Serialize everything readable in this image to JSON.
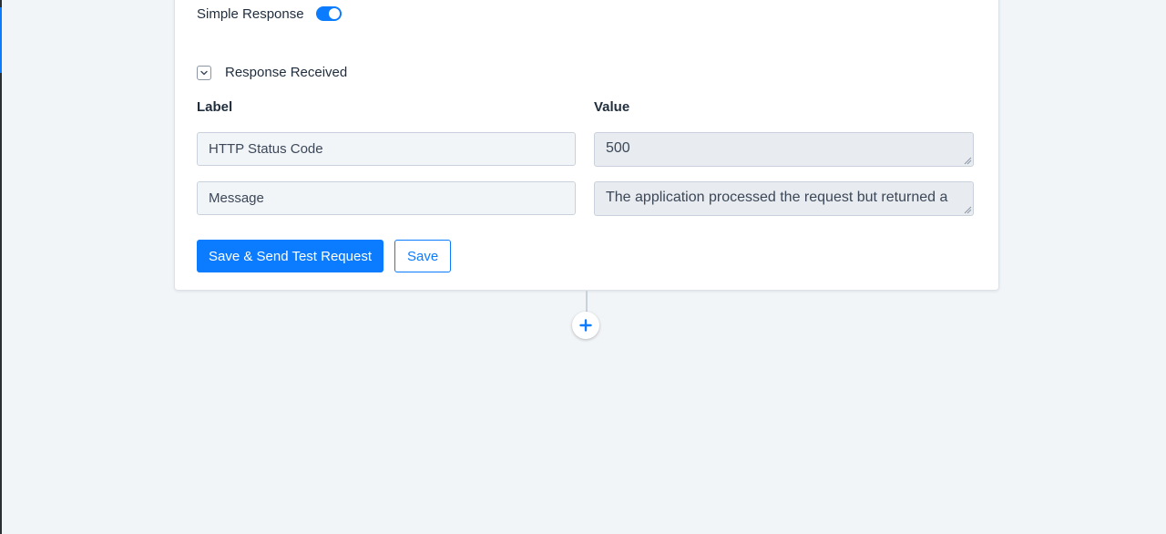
{
  "colors": {
    "accent": "#0b7cff",
    "background": "#f2f5f8",
    "card": "#ffffff"
  },
  "simple_response": {
    "label": "Simple Response",
    "toggle_on": true,
    "toggle_icon": "toggle-switch-icon"
  },
  "response_received": {
    "label": "Response Received",
    "collapse_icon": "chevron-down-icon",
    "headers": {
      "label": "Label",
      "value": "Value"
    },
    "rows": [
      {
        "label": "HTTP Status Code",
        "value": "500"
      },
      {
        "label": "Message",
        "value": "The application processed the request but returned a"
      }
    ]
  },
  "actions": {
    "save_and_send_label": "Save & Send Test Request",
    "save_label": "Save"
  },
  "add_step": {
    "icon": "plus-icon"
  }
}
